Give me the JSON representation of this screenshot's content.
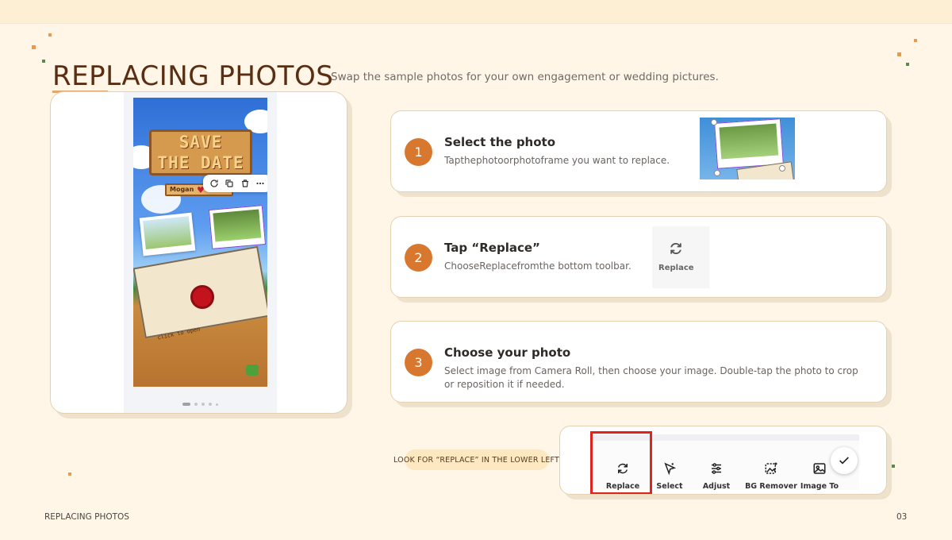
{
  "slide": {
    "title": "REPLACING PHOTOS",
    "subtitle": "Swap the sample photos for your own engagement or wedding pictures."
  },
  "preview": {
    "sign_line1": "SAVE",
    "sign_line2": "THE DATE",
    "nameplate": "Mogan",
    "envelope_text": "click to open"
  },
  "steps": [
    {
      "number": "1",
      "title": "Select the photo",
      "description": "Tapthephotoorphotoframe you want to replace."
    },
    {
      "number": "2",
      "title": "Tap “Replace”",
      "description": "ChooseReplacefromthe bottom toolbar.",
      "thumb_label": "Replace"
    },
    {
      "number": "3",
      "title": "Choose your photo",
      "description": "Select  image from Camera Roll, then choose your image. Double-tap the photo to crop or reposition it if needed."
    }
  ],
  "hint": "LOOK FOR “REPLACE” IN THE LOWER LEFT",
  "toolbar": {
    "tools": [
      "Replace",
      "Select",
      "Adjust",
      "BG Remover",
      "Image To"
    ]
  },
  "footer": {
    "left": "REPLACING PHOTOS",
    "page": "03"
  },
  "colors": {
    "background": "#fff6e8",
    "accent": "#d8782f",
    "title": "#5a2e12",
    "highlight": "#e0231c"
  }
}
